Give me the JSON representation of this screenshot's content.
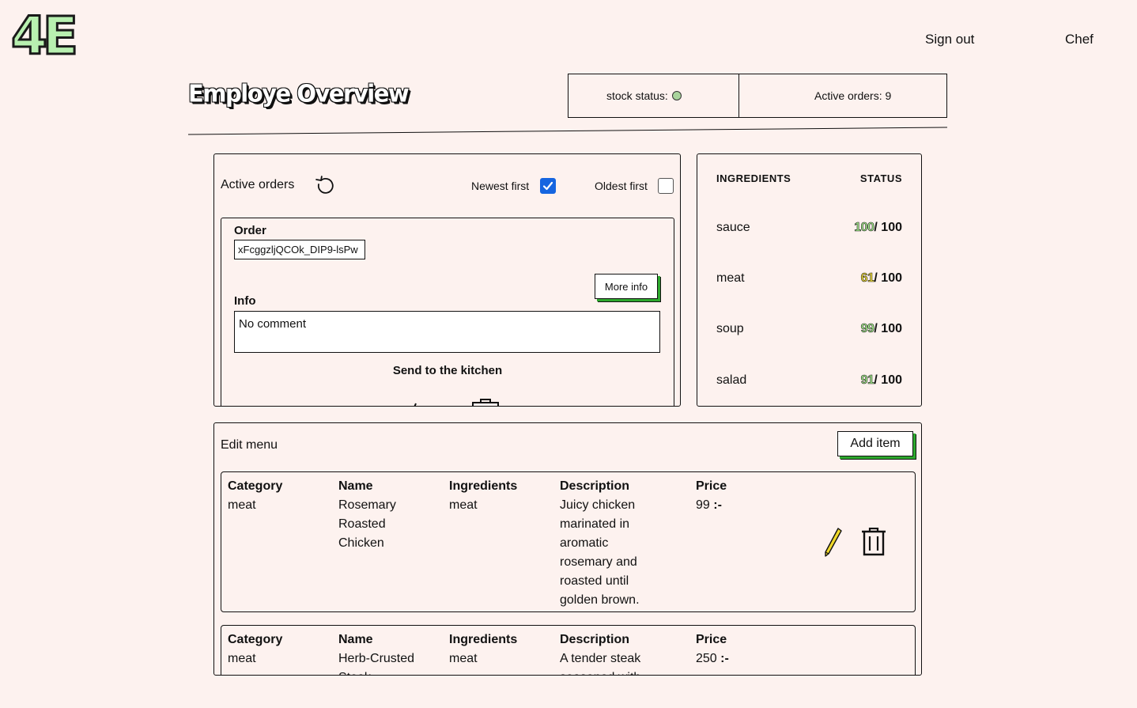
{
  "logo": {
    "text": "4E"
  },
  "nav": {
    "sign_out": "Sign out",
    "role": "Chef"
  },
  "page": {
    "title": "Employe Overview"
  },
  "status": {
    "stock_label": "stock status:",
    "stock_indicator_color": "#a9d49c",
    "active_orders": "Active orders: 9"
  },
  "orders": {
    "heading": "Active orders",
    "newest_first": {
      "label": "Newest first",
      "checked": true
    },
    "oldest_first": {
      "label": "Oldest first",
      "checked": false
    },
    "current": {
      "order_label": "Order",
      "order_id": "xFcggzljQCOk_DIP9-lsPw",
      "more_info": "More info",
      "info_label": "Info",
      "info": "No comment",
      "send": "Send to the kitchen"
    }
  },
  "ingredients": {
    "header_name": "INGREDIENTS",
    "header_status": "STATUS",
    "rows": [
      {
        "name": "sauce",
        "stock": "100",
        "max": "/ 100",
        "level": "green"
      },
      {
        "name": "meat",
        "stock": "61",
        "max": "/ 100",
        "level": "yellow"
      },
      {
        "name": "soup",
        "stock": "99",
        "max": "/ 100",
        "level": "green"
      },
      {
        "name": "salad",
        "stock": "91",
        "max": "/ 100",
        "level": "green"
      }
    ]
  },
  "menu": {
    "title": "Edit menu",
    "add_item": "Add item",
    "headers": {
      "category": "Category",
      "name": "Name",
      "ingredients": "Ingredients",
      "description": "Description",
      "price": "Price"
    },
    "items": [
      {
        "category": "meat",
        "name": "Rosemary Roasted Chicken",
        "ingredients": "meat",
        "description": "Juicy chicken marinated in aromatic rosemary and roasted until golden brown.",
        "price": "99",
        "currency": ":-"
      },
      {
        "category": "meat",
        "name": "Herb-Crusted Steak",
        "ingredients": "meat",
        "description": "A tender steak seasoned with",
        "price": "250",
        "currency": ":-"
      }
    ]
  },
  "colors": {
    "background": "#fdf2ef",
    "accent_green": "#2ea92e",
    "checkbox_blue": "#1565e0",
    "pencil_yellow": "#f0d92a"
  }
}
